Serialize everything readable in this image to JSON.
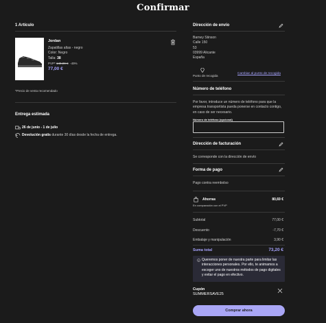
{
  "header": {
    "title": "Confirmar"
  },
  "cart": {
    "count_label": "1 Artículo",
    "item": {
      "brand": "Jordan",
      "name": "Zapatillas altas - negro",
      "color": "Color: Negro",
      "size_label": "Talla: ",
      "size_value": "38",
      "pvp_label": "PVP*",
      "pvp_old": "149,99 €",
      "discount": "-49%",
      "price": "77,00 €"
    },
    "footnote": "*Precio de venta recomendado"
  },
  "delivery": {
    "heading": "Entrega estimada",
    "dates": "26 de junio - 1 de julio",
    "returns_bold": "Devolución gratis",
    "returns_rest": " durante 30 días desde la fecha de entrega."
  },
  "shipping": {
    "heading": "Dirección de envío",
    "address": [
      "Barney Stinson",
      "Calle 150",
      "53",
      "03999 Alicante",
      "España"
    ],
    "pickup_label": "Punto de recogida",
    "pickup_link": "Cambiar al punto de recogida"
  },
  "phone": {
    "heading": "Número de teléfono",
    "description": "Por favor, introduce un número de teléfono para que la empresa transportista pueda ponerse en contacto contigo, en caso de ser necesario.",
    "field_label": "Número de teléfono (opcional)",
    "value": ""
  },
  "billing": {
    "heading": "Dirección de facturación",
    "text": "Se corresponde con la dirección de envío"
  },
  "payment": {
    "heading": "Forma de pago",
    "method": "Pago contra reembolso"
  },
  "summary": {
    "savings_label": "Ahorras",
    "savings_value": "80,69 €",
    "savings_note": "En comparación con el PVP",
    "rows": [
      {
        "label": "Subtotal",
        "value": "77,00 €"
      },
      {
        "label": "Descuento",
        "value": "-7,70 €"
      },
      {
        "label": "Embalaje y manipulación",
        "value": "3,90 €"
      }
    ],
    "total_label": "Suma total",
    "total_value": "73,20 €"
  },
  "notice": "Queremos poner de nuestra parte para limitar las interacciones personales. Por ello, te animamos a escoger uno de nuestros métodos de pago digitales y evitar el pago en efectivo.",
  "coupon": {
    "label": "Cupón",
    "code": "SUMMERSAVE25"
  },
  "cta": {
    "label": "Comprar ahora"
  }
}
